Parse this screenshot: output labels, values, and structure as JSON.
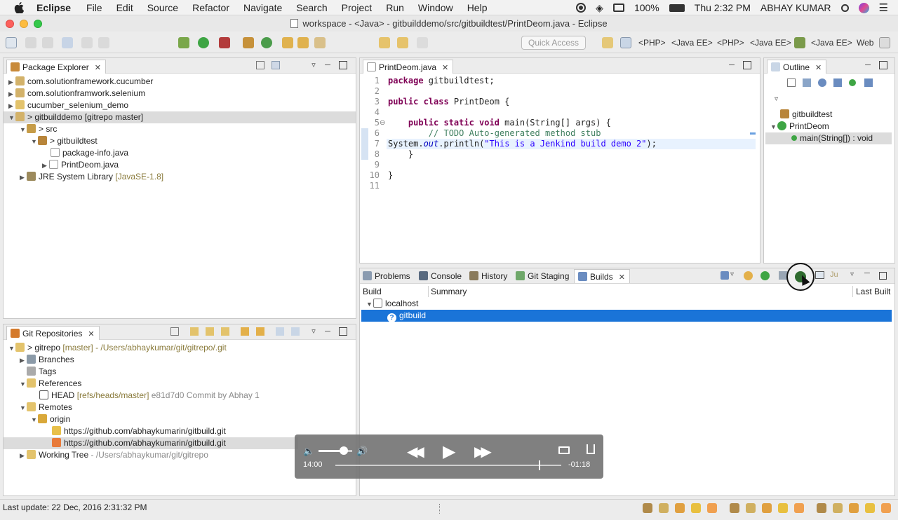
{
  "menubar": {
    "app_name": "Eclipse",
    "items": [
      "File",
      "Edit",
      "Source",
      "Refactor",
      "Navigate",
      "Search",
      "Project",
      "Run",
      "Window",
      "Help"
    ],
    "battery": "100%",
    "clock": "Thu 2:32 PM",
    "user": "ABHAY KUMAR"
  },
  "window": {
    "title": "workspace - <Java> - gitbuilddemo/src/gitbuildtest/PrintDeom.java - Eclipse"
  },
  "toolbar": {
    "quick_access_placeholder": "Quick Access",
    "perspectives": [
      "<PHP>",
      "<Java EE>",
      "<PHP>",
      "<Java EE>",
      "<Java EE>",
      "Web"
    ]
  },
  "package_explorer": {
    "tab_label": "Package Explorer",
    "items": [
      {
        "label": "com.solutionframework.cucumber",
        "suffix": ""
      },
      {
        "label": "com.solutionframwork.selenium",
        "suffix": ""
      },
      {
        "label": "cucumber_selenium_demo",
        "suffix": ""
      },
      {
        "label": "> gitbuilddemo [gitrepo master]",
        "suffix": ""
      },
      {
        "label": "> src",
        "suffix": ""
      },
      {
        "label": "> gitbuildtest",
        "suffix": ""
      },
      {
        "label": "package-info.java",
        "suffix": ""
      },
      {
        "label": "PrintDeom.java",
        "suffix": ""
      },
      {
        "label": "JRE System Library",
        "suffix": "[JavaSE-1.8]"
      }
    ]
  },
  "git_repositories": {
    "tab_label": "Git Repositories",
    "items": [
      {
        "label": "> gitrepo",
        "suffix": "[master] - /Users/abhaykumar/git/gitrepo/.git"
      },
      {
        "label": "Branches",
        "suffix": ""
      },
      {
        "label": "Tags",
        "suffix": ""
      },
      {
        "label": "References",
        "suffix": ""
      },
      {
        "label": "HEAD",
        "suffix": "[refs/heads/master]",
        "tail": "e81d7d0 Commit by Abhay 1"
      },
      {
        "label": "Remotes",
        "suffix": ""
      },
      {
        "label": "origin",
        "suffix": ""
      },
      {
        "label": "https://github.com/abhaykumarin/gitbuild.git",
        "suffix": ""
      },
      {
        "label": "https://github.com/abhaykumarin/gitbuild.git",
        "suffix": ""
      },
      {
        "label": "Working Tree",
        "suffix": "- /Users/abhaykumar/git/gitrepo"
      }
    ]
  },
  "editor": {
    "tab_label": "PrintDeom.java",
    "line_numbers": [
      "1",
      "2",
      "3",
      "4",
      "5",
      "6",
      "7",
      "8",
      "9",
      "10",
      "11"
    ]
  },
  "outline": {
    "tab_label": "Outline",
    "items": [
      "gitbuildtest",
      "PrintDeom",
      "main(String[]) : void"
    ]
  },
  "bottom_panel": {
    "tabs": [
      "Problems",
      "Console",
      "History",
      "Git Staging",
      "Builds"
    ],
    "columns": [
      "Build",
      "Summary",
      "Last Built"
    ],
    "rows": [
      {
        "label": "localhost"
      },
      {
        "label": "gitbuild"
      }
    ]
  },
  "video_player": {
    "elapsed": "14:00",
    "remaining": "-01:18",
    "progress": 0.9,
    "volume": 0.75
  },
  "status": {
    "last_update": "Last update: 22 Dec, 2016 2:31:32 PM"
  }
}
